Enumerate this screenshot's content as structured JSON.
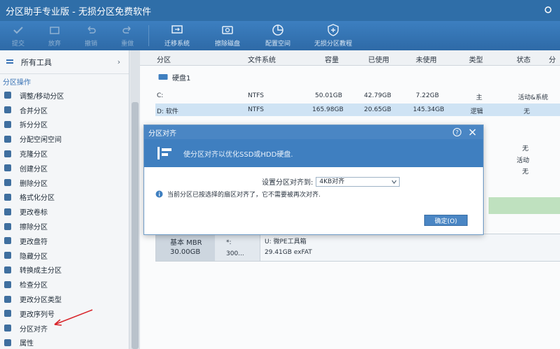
{
  "app": {
    "title": "分区助手专业版 - 无损分区免费软件"
  },
  "toolbar": {
    "items": [
      {
        "label": "提交",
        "icon": "check-icon"
      },
      {
        "label": "放弃",
        "icon": "discard-icon"
      },
      {
        "label": "撤销",
        "icon": "undo-icon"
      },
      {
        "label": "重做",
        "icon": "redo-icon"
      },
      {
        "label": "迁移系统",
        "icon": "migrate-os-icon"
      },
      {
        "label": "擦除磁盘",
        "icon": "wipe-disk-icon"
      },
      {
        "label": "配置空间",
        "icon": "pie-chart-icon"
      },
      {
        "label": "无损分区教程",
        "icon": "tutorial-plus-icon"
      }
    ]
  },
  "sidebar": {
    "all_tools": "所有工具",
    "section": "分区操作",
    "items": [
      "调整/移动分区",
      "合并分区",
      "拆分分区",
      "分配空闲空间",
      "克隆分区",
      "创建分区",
      "删除分区",
      "格式化分区",
      "更改卷标",
      "擦除分区",
      "更改盘符",
      "隐藏分区",
      "转换成主分区",
      "检查分区",
      "更改分区类型",
      "更改序列号",
      "分区对齐",
      "属性"
    ]
  },
  "table": {
    "headers": [
      "分区",
      "文件系统",
      "容量",
      "已使用",
      "未使用",
      "类型",
      "状态",
      "分"
    ],
    "disk_label": "硬盘1",
    "rows": [
      {
        "name": "C:",
        "fs": "NTFS",
        "capacity": "50.01GB",
        "used": "42.79GB",
        "free": "7.22GB",
        "type": "主",
        "status": "活动&系统"
      },
      {
        "name": "D: 软件",
        "fs": "NTFS",
        "capacity": "165.98GB",
        "used": "20.65GB",
        "free": "145.34GB",
        "type": "逻辑",
        "status": "无"
      }
    ],
    "hidden_status": [
      "无",
      "活动",
      "无"
    ]
  },
  "disk_map": {
    "type": "基本 MBR",
    "size": "30.00GB",
    "p1_label": "*:",
    "p1_size": "300...",
    "p2_label": "U: 微PE工具箱",
    "p2_detail": "29.41GB exFAT"
  },
  "dialog": {
    "title": "分区对齐",
    "banner": "使分区对齐以优化SSD或HDD硬盘.",
    "align_label": "设置分区对齐到:",
    "align_value": "4KB对齐",
    "info": "当前分区已按选择的扇区对齐了，它不需要被再次对齐.",
    "ok_label": "确定(O)"
  },
  "colors": {
    "accent": "#3f7fc0",
    "title_bar": "#2f6ea8",
    "annotation": "#d8242a"
  }
}
